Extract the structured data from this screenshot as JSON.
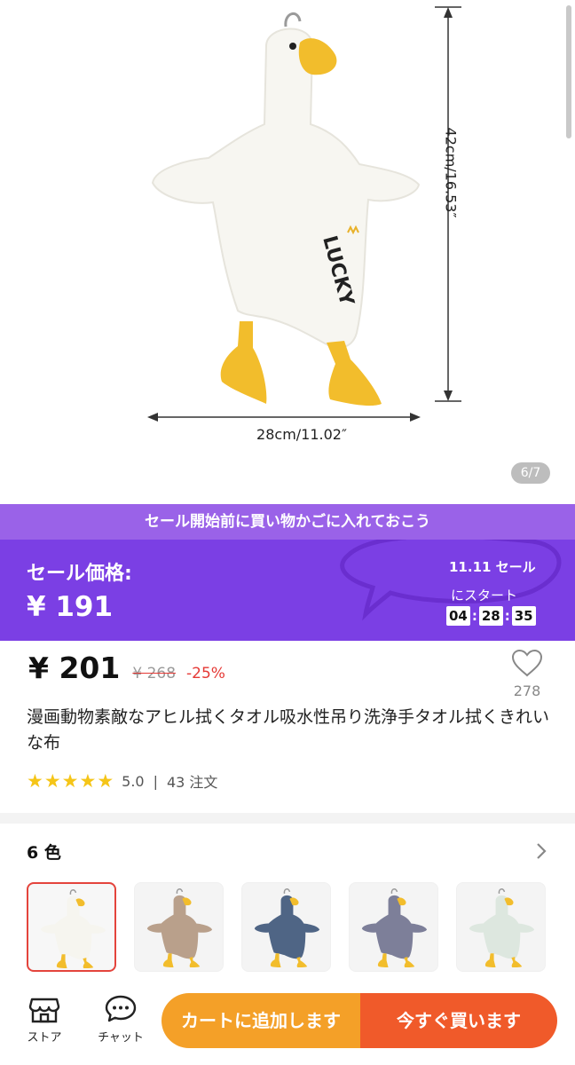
{
  "gallery": {
    "counter": "6/7",
    "height_label": "42cm/16.53″",
    "width_label": "28cm/11.02″",
    "print_text": "LUCKY"
  },
  "sale": {
    "banner_text": "セール開始前に買い物かごに入れておこう",
    "price_label": "セール価格:",
    "sale_price": "¥ 191",
    "event_date": "11.11 セール",
    "start_text": "にスタート",
    "countdown": {
      "hours": "04",
      "minutes": "28",
      "seconds": "35"
    }
  },
  "product": {
    "price": "¥ 201",
    "original_price": "¥ 268",
    "discount": "-25%",
    "favorites": "278",
    "title": "漫画動物素敵なアヒル拭くタオル吸水性吊り洗浄手タオル拭くきれいな布",
    "rating": "5.0",
    "rating_separator": "|",
    "orders": "43 注文",
    "stars": 5
  },
  "variants": {
    "heading": "6 色",
    "items": [
      {
        "name": "white",
        "body": "#f6f5ef",
        "selected": true
      },
      {
        "name": "brown",
        "body": "#b9a08b"
      },
      {
        "name": "navy",
        "body": "#4f6585"
      },
      {
        "name": "grey-purple",
        "body": "#7d7f99"
      },
      {
        "name": "mint",
        "body": "#dde7df"
      }
    ]
  },
  "bottom_bar": {
    "store_label": "ストア",
    "chat_label": "チャット",
    "add_to_cart": "カートに追加します",
    "buy_now": "今すぐ買います"
  },
  "colors": {
    "sale_purple": "#7b3fe4",
    "sale_strip": "#9a62e8",
    "cart_orange": "#f4a028",
    "buy_orange": "#f05a2a",
    "discount_red": "#e53935",
    "star_yellow": "#f5c518"
  }
}
